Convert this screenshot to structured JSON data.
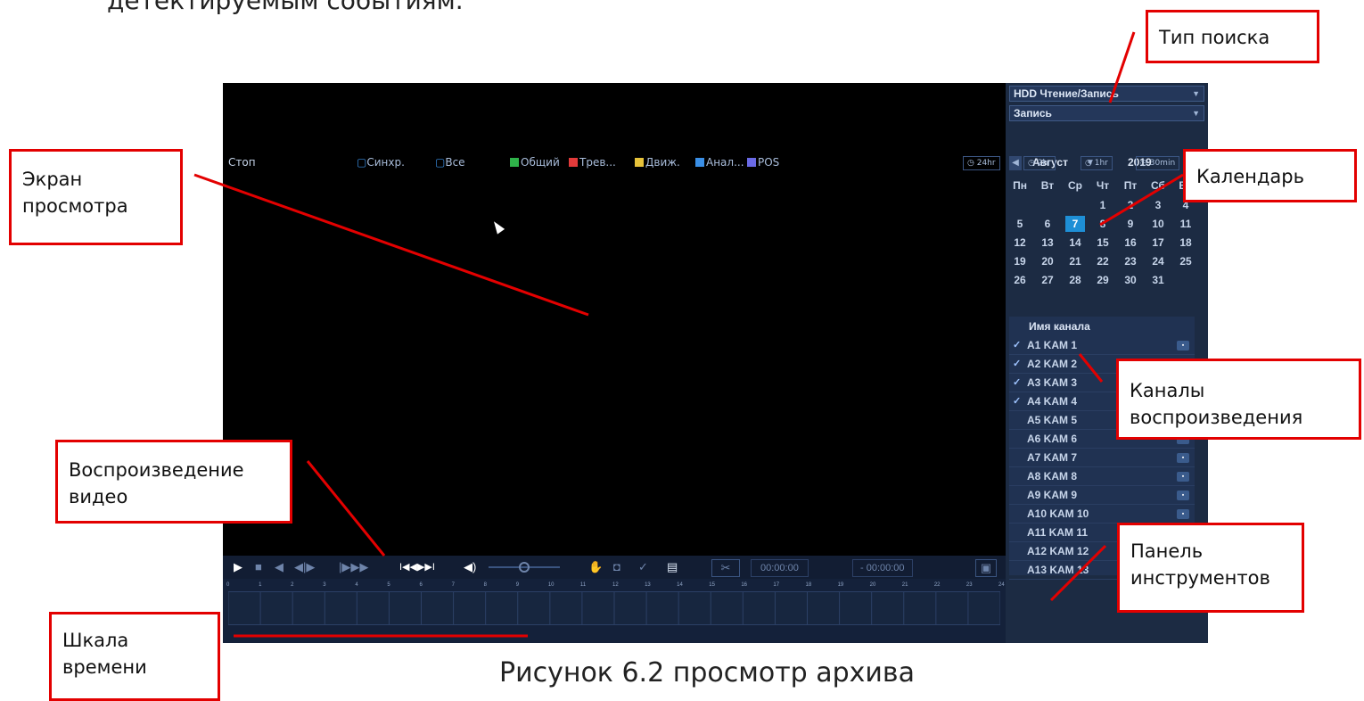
{
  "doc": {
    "top_text": "детектируемым событиям.",
    "caption": "Рисунок 6.2 просмотр архива"
  },
  "callouts": {
    "search_type": "Тип поиска",
    "viewer_l1": "Экран",
    "viewer_l2": "просмотра",
    "calendar": "Календарь",
    "channels_l1": "Каналы",
    "channels_l2": "воспроизведения",
    "playback_l1": "Воспроизведение",
    "playback_l2": "видео",
    "toolbar_l1": "Панель",
    "toolbar_l2": "инструментов",
    "timeline_l1": "Шкала",
    "timeline_l2": "времени"
  },
  "dvr": {
    "search_source": "HDD Чтение/Запись",
    "search_type": "Запись",
    "calendar": {
      "month": "Август",
      "year": "2019",
      "weekdays": [
        "Пн",
        "Вт",
        "Ср",
        "Чт",
        "Пт",
        "Сб",
        "Вс"
      ],
      "selected_day": "7",
      "rows": [
        [
          "",
          "",
          "",
          "1",
          "2",
          "3",
          "4"
        ],
        [
          "5",
          "6",
          "7",
          "8",
          "9",
          "10",
          "11"
        ],
        [
          "12",
          "13",
          "14",
          "15",
          "16",
          "17",
          "18"
        ],
        [
          "19",
          "20",
          "21",
          "22",
          "23",
          "24",
          "25"
        ],
        [
          "26",
          "27",
          "28",
          "29",
          "30",
          "31",
          ""
        ]
      ]
    },
    "channel_header": "Имя канала",
    "channels": [
      {
        "label": "A1 KAM 1",
        "checked": true
      },
      {
        "label": "A2 KAM 2",
        "checked": true
      },
      {
        "label": "A3 KAM 3",
        "checked": true
      },
      {
        "label": "A4 KAM 4",
        "checked": true
      },
      {
        "label": "A5 KAM 5",
        "checked": false
      },
      {
        "label": "A6 KAM 6",
        "checked": false
      },
      {
        "label": "A7 KAM 7",
        "checked": false
      },
      {
        "label": "A8 KAM 8",
        "checked": false
      },
      {
        "label": "A9 KAM 9",
        "checked": false
      },
      {
        "label": "A10 KAM 10",
        "checked": false
      },
      {
        "label": "A11 KAM 11",
        "checked": false
      },
      {
        "label": "A12 KAM 12",
        "checked": false
      },
      {
        "label": "A13 KAM 13",
        "checked": false
      }
    ],
    "time_start": "00:00:00",
    "time_end": "- 00:00:00",
    "hours": [
      "0",
      "1",
      "2",
      "3",
      "4",
      "5",
      "6",
      "7",
      "8",
      "9",
      "10",
      "11",
      "12",
      "13",
      "14",
      "15",
      "16",
      "17",
      "18",
      "19",
      "20",
      "21",
      "22",
      "23",
      "24"
    ],
    "status": {
      "state": "Стоп",
      "sync": "Синхр.",
      "all": "Все",
      "legend": [
        {
          "label": "Общий",
          "color": "#2fb34a"
        },
        {
          "label": "Трев...",
          "color": "#e23a3a"
        },
        {
          "label": "Движ.",
          "color": "#e6c23a"
        },
        {
          "label": "Анал...",
          "color": "#3a8fe6"
        },
        {
          "label": "POS",
          "color": "#6a6ae6"
        }
      ],
      "zoom": [
        "24hr",
        "2hr",
        "1hr",
        "30min"
      ]
    }
  }
}
